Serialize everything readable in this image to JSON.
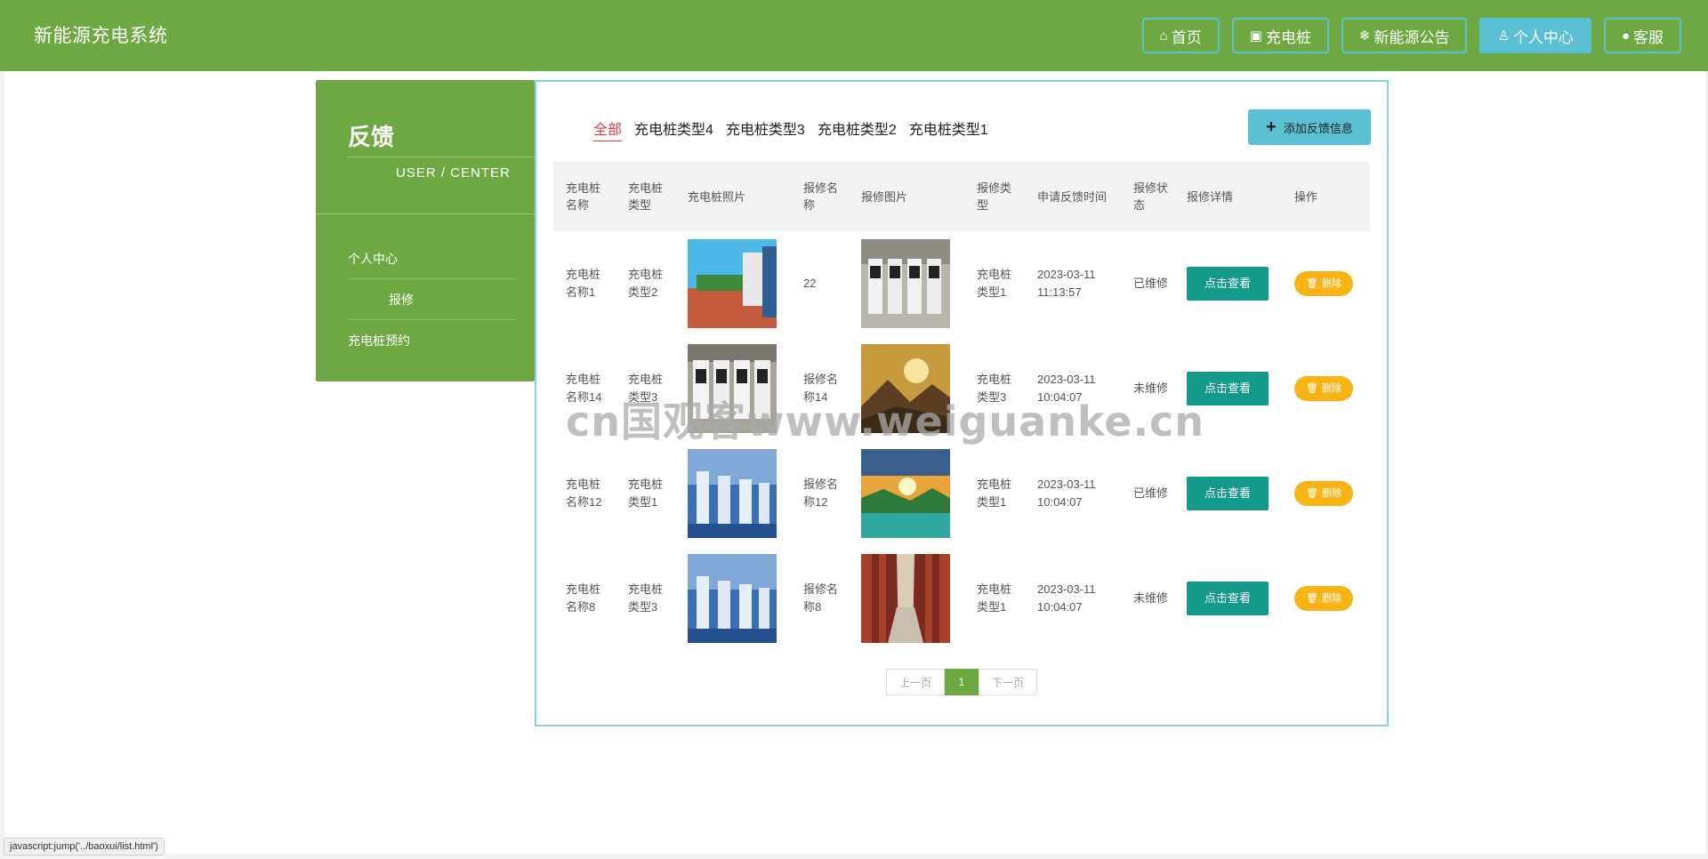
{
  "header": {
    "brand": "新能源充电系统",
    "nav": [
      {
        "icon": "home-icon",
        "glyph": "⌂",
        "label": "首页"
      },
      {
        "icon": "gift-icon",
        "glyph": "▣",
        "label": "充电桩"
      },
      {
        "icon": "snowflake-icon",
        "glyph": "❄",
        "label": "新能源公告"
      },
      {
        "icon": "user-icon",
        "glyph": "♙",
        "label": "个人中心",
        "active": true
      },
      {
        "icon": "wechat-icon",
        "glyph": "●",
        "label": "客服"
      }
    ]
  },
  "sidebar": {
    "title": "反馈",
    "subtitle": "USER / CENTER",
    "items": [
      {
        "label": "个人中心"
      },
      {
        "label": "报修"
      },
      {
        "label": "充电桩预约"
      }
    ]
  },
  "filters": {
    "tabs": [
      "全部",
      "充电桩类型4",
      "充电桩类型3",
      "充电桩类型2",
      "充电桩类型1"
    ],
    "active": "全部"
  },
  "add_button": {
    "label": "添加反馈信息",
    "icon": "plus-icon"
  },
  "table": {
    "headers": [
      "充电桩名称",
      "充电桩类型",
      "充电桩照片",
      "报修名称",
      "报修图片",
      "报修类型",
      "申请反馈时间",
      "报修状态",
      "报修详情",
      "操作"
    ],
    "rows": [
      {
        "name": "充电桩名称1",
        "type": "充电桩类型2",
        "photo": "charging-station-outdoor-photo",
        "repair_name": "22",
        "repair_image": "charging-station-indoor-photo",
        "repair_type": "充电桩类型1",
        "time": "2023-03-11 11:13:57",
        "status": "已维修",
        "detail": "点击查看",
        "action": "删除"
      },
      {
        "name": "充电桩名称14",
        "type": "充电桩类型3",
        "photo": "charging-station-indoor-photo",
        "repair_name": "报修名称14",
        "repair_image": "mountain-sunset-photo",
        "repair_type": "充电桩类型3",
        "time": "2023-03-11 10:04:07",
        "status": "未维修",
        "detail": "点击查看",
        "action": "删除"
      },
      {
        "name": "充电桩名称12",
        "type": "充电桩类型1",
        "photo": "blue-charging-posts-photo",
        "repair_name": "报修名称12",
        "repair_image": "lake-sunrise-photo",
        "repair_type": "充电桩类型1",
        "time": "2023-03-11 10:04:07",
        "status": "已维修",
        "detail": "点击查看",
        "action": "删除"
      },
      {
        "name": "充电桩名称8",
        "type": "充电桩类型3",
        "photo": "blue-charging-posts-photo",
        "repair_name": "报修名称8",
        "repair_image": "red-corridor-photo",
        "repair_type": "充电桩类型1",
        "time": "2023-03-11 10:04:07",
        "status": "未维修",
        "detail": "点击查看",
        "action": "删除"
      }
    ]
  },
  "pagination": {
    "prev": "上一页",
    "current": "1",
    "next": "下一页"
  },
  "watermark": "cn国观客www.weiguanke.cn",
  "status_bar": "javascript:jump('../baoxui/list.html')",
  "colors": {
    "brand_green": "#6ea843",
    "accent_cyan": "#5bc0d3",
    "detail_teal": "#139a8a",
    "delete_yellow": "#f8b414",
    "active_tab_red": "#e03b3b"
  }
}
